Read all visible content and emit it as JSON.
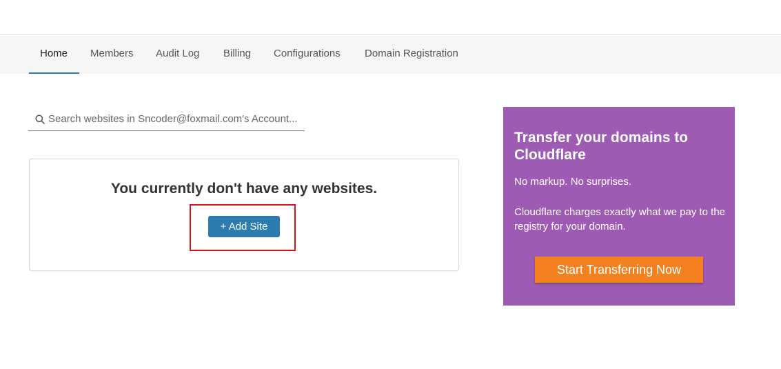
{
  "nav": {
    "tabs": [
      {
        "label": "Home",
        "active": true
      },
      {
        "label": "Members"
      },
      {
        "label": "Audit Log"
      },
      {
        "label": "Billing"
      },
      {
        "label": "Configurations"
      },
      {
        "label": "Domain Registration"
      }
    ]
  },
  "search": {
    "placeholder": "Search websites in Sncoder@foxmail.com's Account...",
    "value": ""
  },
  "empty_state": {
    "title": "You currently don't have any websites.",
    "add_site_label": "+ Add Site"
  },
  "promo": {
    "title": "Transfer your domains to Cloudflare",
    "line1": "No markup. No surprises.",
    "line2": "Cloudflare charges exactly what we pay to the registry for your domain.",
    "button_label": "Start Transferring Now"
  },
  "colors": {
    "accent": "#2c7cb0",
    "promo_background": "#9e5bb3",
    "promo_button": "#f48120",
    "highlight": "#d9161c"
  }
}
